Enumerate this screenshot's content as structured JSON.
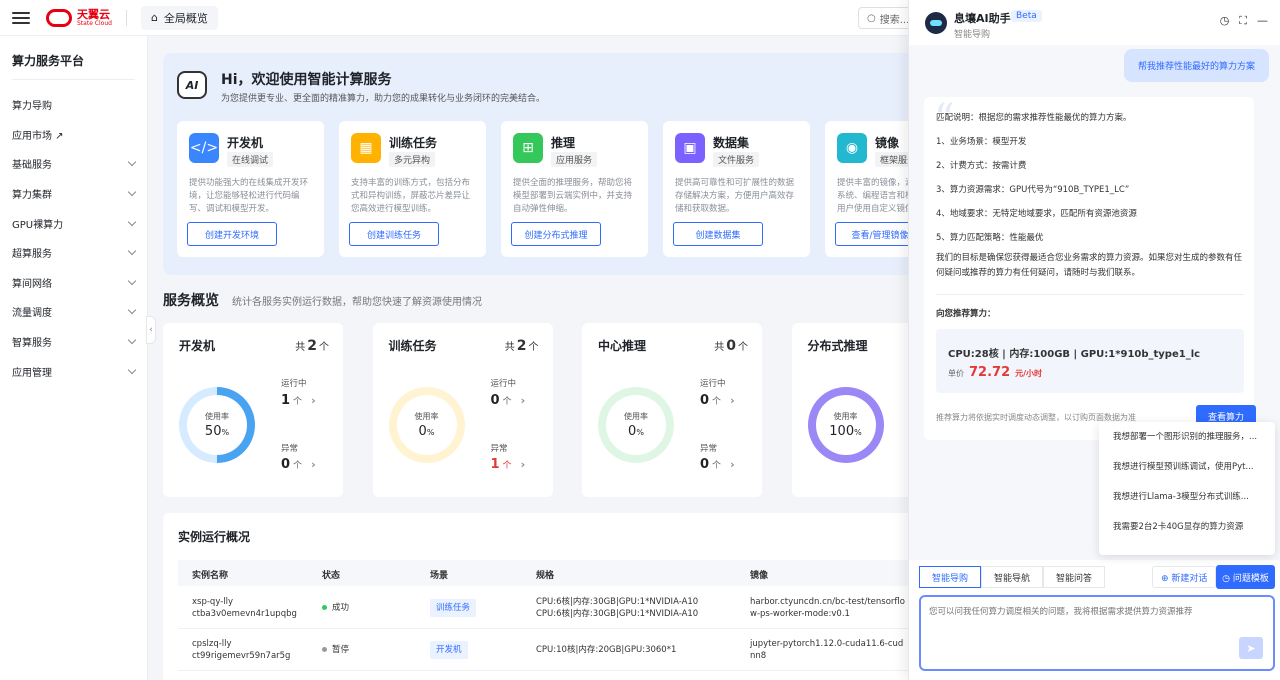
{
  "topbar": {
    "logo_cn": "天翼云",
    "logo_en": "State Cloud",
    "overview_tab": "全局概览",
    "search_placeholder": "搜索..."
  },
  "sidebar": {
    "title": "算力服务平台",
    "items": [
      {
        "label": "算力导购",
        "expandable": false
      },
      {
        "label": "应用市场 ↗",
        "expandable": false
      },
      {
        "label": "基础服务",
        "expandable": true
      },
      {
        "label": "算力集群",
        "expandable": true
      },
      {
        "label": "GPU裸算力",
        "expandable": true
      },
      {
        "label": "超算服务",
        "expandable": true
      },
      {
        "label": "算间网络",
        "expandable": true
      },
      {
        "label": "流量调度",
        "expandable": true
      },
      {
        "label": "智算服务",
        "expandable": true
      },
      {
        "label": "应用管理",
        "expandable": true
      }
    ]
  },
  "hero": {
    "badge": "AI",
    "title": "Hi，欢迎使用智能计算服务",
    "subtitle": "为您提供更专业、更全面的精准算力，助力您的成果转化与业务闭环的完美结合。",
    "cards": [
      {
        "title": "开发机",
        "tag": "在线调试",
        "desc": "提供功能强大的在线集成开发环境，让您能够轻松进行代码编写、调试和模型开发。",
        "button": "创建开发环境",
        "color": "#3a86ff",
        "glyph": "</>"
      },
      {
        "title": "训练任务",
        "tag": "多元异构",
        "desc": "支持丰富的训练方式，包括分布式和异构训练，屏蔽芯片差异让您高效进行模型训练。",
        "button": "创建训练任务",
        "color": "#ffb300",
        "glyph": "▦"
      },
      {
        "title": "推理",
        "tag": "应用服务",
        "desc": "提供全面的推理服务，帮助您将模型部署到云端实例中，并支持自动弹性伸缩。",
        "button": "创建分布式推理",
        "color": "#34c759",
        "glyph": "⊞"
      },
      {
        "title": "数据集",
        "tag": "文件服务",
        "desc": "提供高可靠性和可扩展性的数据存储解决方案，方便用户高效存储和获取数据。",
        "button": "创建数据集",
        "color": "#7b61ff",
        "glyph": "▣"
      },
      {
        "title": "镜像",
        "tag": "框架服务",
        "desc": "提供丰富的镜像，涵盖多种操作系统、编程语言和框架等，支持用户使用自定义镜像。",
        "button": "查看/管理镜像",
        "color": "#22b8cf",
        "glyph": "◉"
      }
    ]
  },
  "overview": {
    "title": "服务概览",
    "subtitle": "统计各服务实例运行数据，帮助您快速了解资源使用情况",
    "stats": [
      {
        "title": "开发机",
        "total_prefix": "共",
        "total": "2",
        "unit": "个",
        "usage_label": "使用率",
        "usage": "50",
        "pct": "%",
        "usage_fraction": 0.5,
        "ring_color": "#4aa3f0",
        "track_color": "#d6ebff",
        "running_label": "运行中",
        "running": "1",
        "abnormal_label": "异常",
        "abnormal": "0",
        "abnormal_red": false
      },
      {
        "title": "训练任务",
        "total_prefix": "共",
        "total": "2",
        "unit": "个",
        "usage_label": "使用率",
        "usage": "0",
        "pct": "%",
        "usage_fraction": 0,
        "ring_color": "#ffcf5c",
        "track_color": "#fff3d1",
        "running_label": "运行中",
        "running": "0",
        "abnormal_label": "异常",
        "abnormal": "1",
        "abnormal_red": true
      },
      {
        "title": "中心推理",
        "total_prefix": "共",
        "total": "0",
        "unit": "个",
        "usage_label": "使用率",
        "usage": "0",
        "pct": "%",
        "usage_fraction": 0,
        "ring_color": "#6ed38a",
        "track_color": "#dff6e5",
        "running_label": "运行中",
        "running": "0",
        "abnormal_label": "异常",
        "abnormal": "0",
        "abnormal_red": false
      },
      {
        "title": "分布式推理",
        "total_prefix": "",
        "total": "",
        "unit": "",
        "usage_label": "使用率",
        "usage": "100",
        "pct": "%",
        "usage_fraction": 1,
        "ring_color": "#9b87f5",
        "track_color": "#ece7ff",
        "running_label": "",
        "running": "",
        "abnormal_label": "",
        "abnormal": "",
        "abnormal_red": false
      }
    ],
    "count_unit": "个",
    "arrow": "›"
  },
  "instances": {
    "title": "实例运行概况",
    "pager_prev": "‹",
    "columns": [
      "实例名称",
      "状态",
      "场景",
      "规格",
      "镜像"
    ],
    "rows": [
      {
        "name1": "xsp-qy-lly",
        "name2": "ctba3v0emevn4r1upqbg",
        "status": "成功",
        "status_color": "#34c759",
        "scene": "训练任务",
        "spec1": "CPU:6核|内存:30GB|GPU:1*NVIDIA-A10",
        "spec2": "CPU:6核|内存:30GB|GPU:1*NVIDIA-A10",
        "image1": "harbor.ctyuncdn.cn/bc-test/tensorflo",
        "image2": "w-ps-worker-mode:v0.1"
      },
      {
        "name1": "cpslzq-lly",
        "name2": "ct99rigemevr59n7ar5g",
        "status": "暂停",
        "status_color": "#999999",
        "scene": "开发机",
        "spec1": "CPU:10核|内存:20GB|GPU:3060*1",
        "spec2": "",
        "image1": "jupyter-pytorch1.12.0-cuda11.6-cud",
        "image2": "nn8"
      }
    ]
  },
  "assistant": {
    "title": "息壤AI助手",
    "beta": "Beta",
    "subtitle": "智能导购",
    "user_message": "帮我推荐性能最好的算力方案",
    "answer_lines": [
      "匹配说明：根据您的需求推荐性能最优的算力方案。",
      "1、业务场景：模型开发",
      "2、计费方式：按需计费",
      "3、算力资源需求：GPU代号为“910B_TYPE1_LC”",
      "4、地域要求：无特定地域要求，匹配所有资源池资源",
      "5、算力匹配策略：性能最优"
    ],
    "answer_para": "我们的目标是确保您获得最适合您业务需求的算力资源。如果您对生成的参数有任何疑问或推荐的算力有任何疑问，请随时与我们联系。",
    "rec_title": "向您推荐算力：",
    "rec_spec": "CPU:28核 | 内存:100GB | GPU:1*910b_type1_lc",
    "price_label": "单价",
    "price": "72.72",
    "price_unit": "元/小时",
    "note": "推荐算力将依据实时调度动态调整，以订购页面数据为准",
    "view_button": "查看算力",
    "suggestions": [
      "我想部署一个图形识别的推理服务，...",
      "我想进行模型预训练调试，使用Pyt...",
      "我想进行Llama-3模型分布式训练...",
      "我需要2台2卡40G显存的算力资源"
    ],
    "tabs": [
      "智能导购",
      "智能导航",
      "智能问答"
    ],
    "new_chat": "⊕ 新建对话",
    "template": "◷ 问题模板",
    "input_placeholder": "您可以问我任何算力调度相关的问题，我将根据需求提供算力资源推荐"
  }
}
